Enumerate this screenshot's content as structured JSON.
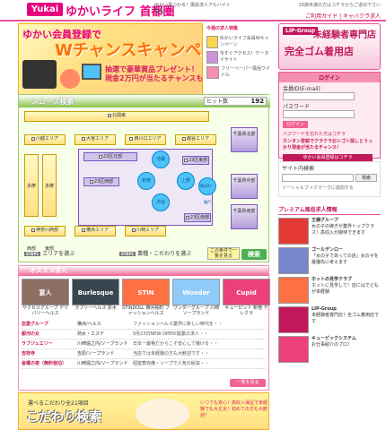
{
  "header": {
    "logo": "Yukai",
    "site_title": "ゆかいライフ 首都圏",
    "tagline": "ゆかい見つかる！風俗求人アルバイト情報",
    "top_link": "18歳未満の方はコチラからご退出下さい",
    "links": "ご利用ガイド | キャバクラ求人"
  },
  "banner": {
    "line1": "ゆかい会員登録で",
    "line2": "Wチャンスキャンペーン",
    "line3": "抽選で豪華賞品プレゼント！",
    "line4": "現金2万円が当たるチャンスも！"
  },
  "new_jobs": {
    "title": "今週の求人特集",
    "items": [
      {
        "text": "ゆかいライフ会員Wキャンペーン"
      },
      {
        "text": "今すぐアクセス！ケータイサイト"
      },
      {
        "text": "フリーペーパー風俗ワイドル"
      }
    ]
  },
  "lip": {
    "brand": "LIP-Group",
    "line1": "未経験者専門店",
    "line2": "完全ゴム着用店"
  },
  "login": {
    "title": "ログイン",
    "id_label": "会員ID(E-mail)",
    "pw_label": "パスワード",
    "button": "ログイン",
    "forgot": "パスワードを忘れた方はコチラ",
    "promo": "カンタン登録でクラクラおシゴト探しとうっかり現金が当たるチャンス！",
    "register": "ゆかい会員登録はコチラ"
  },
  "search": {
    "title": "スムーズ検索",
    "hit_label": "ヒット数",
    "hit_count": "192",
    "step1": "エリアを選ぶ",
    "step2": "業種・こだわりを選ぶ",
    "check_label": "この条件で一覧を見る",
    "search_btn": "検索",
    "areas": {
      "kita": "北関東",
      "kawagoe": "川越エリア",
      "omiya": "大宮エリア",
      "nishikawaguchi": "西川口エリア",
      "koshigaya": "越谷エリア",
      "tama_nishi": "多摩西部",
      "tama_higashi": "多摩東部",
      "k23_kita": "23区北部",
      "k23_nishi": "23区西部",
      "k23_higashi": "23区東部",
      "k23_minami": "23区南部",
      "shinjuku": "新宿",
      "ikebukuro": "池袋",
      "ueno": "上野",
      "shibuya": "渋谷",
      "kinshicho": "錦糸町・亀戸",
      "chiba_hoku": "千葉県北部",
      "chiba_chu": "千葉県中部",
      "chiba_nan": "千葉県南部",
      "kanagawa": "神奈川西部",
      "yokohama": "横浜エリア",
      "kawasaki": "川崎エリア"
    }
  },
  "osusume": {
    "title": "オススメ求人",
    "cards": [
      {
        "name": "サクセスグループ デリバリーヘルス",
        "color": "#8d6e63",
        "label": "宴人"
      },
      {
        "name": "ラブリーヘルス 厚木",
        "color": "#37474f",
        "label": "Burlesque"
      },
      {
        "name": "STINDOLL 横浜桜町 ファッションヘルス",
        "color": "#ff7043",
        "label": "STIN"
      },
      {
        "name": "ワンダーグループ 川崎 ソープランド",
        "color": "#90caf9",
        "label": "Wonder"
      },
      {
        "name": "キューピット 新宿 テレクラ",
        "color": "#ec407a",
        "label": "Cupid"
      }
    ],
    "rows": [
      {
        "c1": "恋愛グループ",
        "c2": "横浜/ヘルス",
        "c3": "ファッションヘルス業界に新しい時代を・・"
      },
      {
        "c1": "銀河の女",
        "c2": "熟女・エステ",
        "c3": "9月23日NEW OPEN!開業の求人・・"
      },
      {
        "c1": "ラブジュエリー",
        "c2": "川崎堀之内/ソープランド",
        "c3": "日本一厳格だからこそ安心して働ける・・"
      },
      {
        "c1": "吉祥寺",
        "c2": "吉原/ソープランド",
        "c3": "当店では未経験の方も大歓迎です・・"
      },
      {
        "c1": "金曜の夜（無料宿泊）",
        "c2": "川崎堀之内/ソープランド",
        "c3": "個室寮完備・ソープで人気の秘訣・・"
      }
    ],
    "more_btn": "一覧を見る"
  },
  "promo": {
    "line1": "運べるこだわり全21項目",
    "line2": "こだわり検索",
    "line3": "いつでも安心！高収入保証で未経験でも大丈夫！初めての方も大歓迎！"
  },
  "side_search": {
    "title": "サイト内検索",
    "btn": "検索",
    "social": "ソーシャルブックマークに追加する"
  },
  "premium": {
    "title": "プレミアム風俗求人情報",
    "items": [
      {
        "name": "王様グループ",
        "text": "女の子の稼ぎが業界トップクラス！高収入が期待できます"
      },
      {
        "name": "ゴールデンロー",
        "text": "「女の子であっての店」女の子を最優先に考えます"
      },
      {
        "name": "ホットの見学クラブ",
        "text": "ホットに見学して！店にはでどもが未経験"
      },
      {
        "name": "LIP-Group",
        "text": "未経験者専門店！全ゴム着用店です"
      },
      {
        "name": "キューピックシステム",
        "text": "お仕事紹介のプロ！"
      }
    ]
  }
}
